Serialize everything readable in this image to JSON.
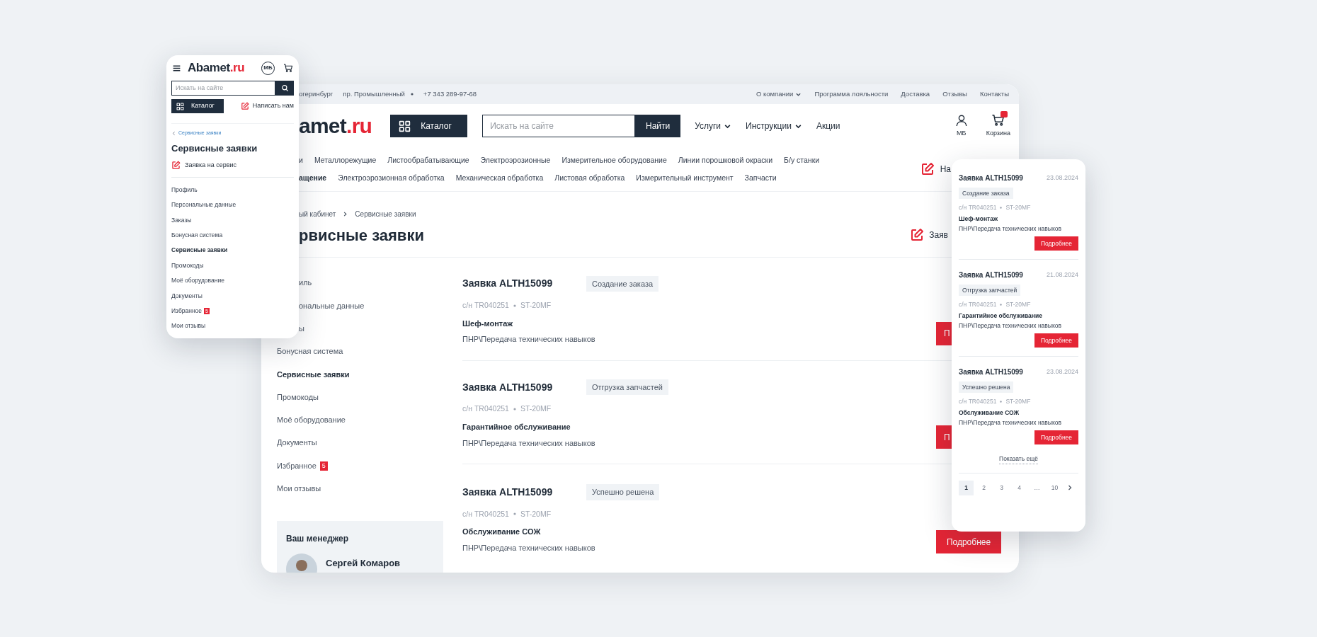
{
  "phone_left": {
    "logo": {
      "text": "Abamet",
      "accent": ".ru"
    },
    "user_initials": "МБ",
    "search": {
      "placeholder": "Искать на сайте"
    },
    "catalog_button": "Каталог",
    "write_us": "Написать нам",
    "back_link": "Сервисные заявки",
    "title": "Сервисные заявки",
    "service_request_link": "Заявка на сервис",
    "menu": [
      {
        "label": "Профиль",
        "selected": false
      },
      {
        "label": "Персональные данные",
        "selected": false
      },
      {
        "label": "Заказы",
        "selected": false
      },
      {
        "label": "Бонусная система",
        "selected": false
      },
      {
        "label": "Сервисные заявки",
        "selected": true
      },
      {
        "label": "Промокоды",
        "selected": false
      },
      {
        "label": "Моё оборудование",
        "selected": false
      },
      {
        "label": "Документы",
        "selected": false
      },
      {
        "label": "Избранное",
        "selected": false,
        "badge": "5"
      },
      {
        "label": "Мои отзывы",
        "selected": false
      }
    ]
  },
  "desktop": {
    "top_bar": {
      "left": [
        "огеринбург",
        "пр. Промышленный",
        "+7 343 289-97-68"
      ],
      "right": [
        {
          "label": "О компании",
          "dropdown": true
        },
        {
          "label": "Программа лояльности",
          "dropdown": false
        },
        {
          "label": "Доставка",
          "dropdown": false
        },
        {
          "label": "Отзывы",
          "dropdown": false
        },
        {
          "label": "Контакты",
          "dropdown": false
        }
      ]
    },
    "header": {
      "logo": {
        "text": "amet",
        "accent": ".ru"
      },
      "catalog_button": "Каталог",
      "search": {
        "placeholder": "Искать на сайте",
        "button": "Найти"
      },
      "nav": [
        {
          "label": "Услуги",
          "dropdown": true
        },
        {
          "label": "Инструкции",
          "dropdown": true
        },
        {
          "label": "Акции",
          "dropdown": false
        }
      ],
      "user_label": "МБ",
      "cart_label": "Корзина"
    },
    "categories_row_1": [
      {
        "label": "и",
        "selected": false
      },
      {
        "label": "Металлорежущие",
        "selected": false
      },
      {
        "label": "Листообрабатывающие",
        "selected": false
      },
      {
        "label": "Электроэрозионные",
        "selected": false
      },
      {
        "label": "Измерительное оборудование",
        "selected": false
      },
      {
        "label": "Линии порошковой окраски",
        "selected": false
      },
      {
        "label": "Б/у станки",
        "selected": false
      }
    ],
    "categories_row_2": [
      {
        "label": "ащение",
        "selected": true
      },
      {
        "label": "Электроэрозионная обработка",
        "selected": false
      },
      {
        "label": "Механическая обработка",
        "selected": false
      },
      {
        "label": "Листовая обработка",
        "selected": false
      },
      {
        "label": "Измерительный инструмент",
        "selected": false
      },
      {
        "label": "Запчасти",
        "selected": false
      }
    ],
    "write_us": "На",
    "breadcrumbs": [
      "ый кабинет",
      "Сервисные заявки"
    ],
    "title": "рвисные заявки",
    "service_request_link": "Заяв",
    "sidebar": [
      {
        "label": "иль",
        "selected": false
      },
      {
        "label": "ональные данные",
        "selected": false
      },
      {
        "label": "ы",
        "selected": false
      },
      {
        "label": "Бонусная система",
        "selected": false
      },
      {
        "label": "Сервисные заявки",
        "selected": true
      },
      {
        "label": "Промокоды",
        "selected": false
      },
      {
        "label": "Моё оборудование",
        "selected": false
      },
      {
        "label": "Документы",
        "selected": false
      },
      {
        "label": "Избранное",
        "selected": false,
        "badge": "5"
      },
      {
        "label": "Мои отзывы",
        "selected": false
      }
    ],
    "manager": {
      "heading": "Ваш менеджер",
      "name": "Сергей Комаров"
    },
    "requests": [
      {
        "title": "Заявка ALTH15099",
        "status": "Создание заказа",
        "serial": "с/н TR040251",
        "model": "ST-20MF",
        "service": "Шеф-монтаж",
        "description": "ПНР\\Передача технических навыков",
        "button": "П"
      },
      {
        "title": "Заявка ALTH15099",
        "status": "Отгрузка запчастей",
        "serial": "с/н TR040251",
        "model": "ST-20MF",
        "service": "Гарантийное обслуживание",
        "description": "ПНР\\Передача технических навыков",
        "button": "П"
      },
      {
        "title": "Заявка ALTH15099",
        "status": "Успешно решена",
        "serial": "с/н TR040251",
        "model": "ST-20MF",
        "service": "Обслуживание СОЖ",
        "description": "ПНР\\Передача технических навыков",
        "button": "Подробнее"
      }
    ]
  },
  "phone_right": {
    "requests": [
      {
        "title": "Заявка ALTH15099",
        "date": "23.08.2024",
        "status": "Создание заказа",
        "serial": "с/н TR040251",
        "model": "ST-20MF",
        "service": "Шеф-монтаж",
        "description": "ПНР\\Передача технических навыков",
        "button": "Подробнее"
      },
      {
        "title": "Заявка ALTH15099",
        "date": "21.08.2024",
        "status": "Отгрузка запчастей",
        "serial": "с/н TR040251",
        "model": "ST-20MF",
        "service": "Гарантийное обслуживание",
        "description": "ПНР\\Передача технических навыков",
        "button": "Подробнее"
      },
      {
        "title": "Заявка ALTH15099",
        "date": "23.08.2024",
        "status": "Успешно решена",
        "serial": "с/н TR040251",
        "model": "ST-20MF",
        "service": "Обслуживание СОЖ",
        "description": "ПНР\\Передача технических навыков",
        "button": "Подробнее"
      }
    ],
    "show_more": "Показать ещё",
    "pagination": [
      {
        "label": "1",
        "selected": true
      },
      {
        "label": "2",
        "selected": false
      },
      {
        "label": "3",
        "selected": false
      },
      {
        "label": "4",
        "selected": false
      },
      {
        "label": "…",
        "selected": false
      },
      {
        "label": "10",
        "selected": false
      }
    ]
  }
}
